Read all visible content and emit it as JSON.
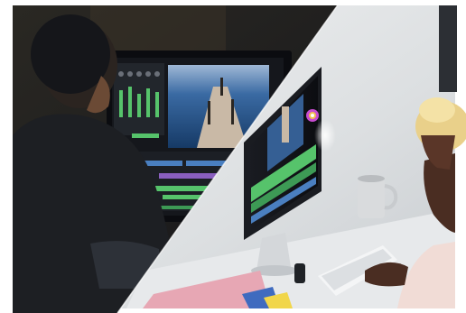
{
  "image": {
    "kind": "photo-collage",
    "panels": [
      "video-editor-dark-room",
      "colorist-bright-office"
    ],
    "left_panel": {
      "subject": "man-at-editing-monitor",
      "monitor_content": [
        "audio-mixer-panel",
        "pier-video-preview",
        "timeline-tracks"
      ]
    },
    "right_panel": {
      "subject": "woman-at-laptop",
      "objects": [
        "angled-monitor",
        "color-wheel-icon",
        "coffee-mug",
        "keyboard",
        "notebooks"
      ]
    },
    "colors": {
      "dark_bg": "#1b1c20",
      "bright_bg": "#e4e6e8",
      "monitor_glow": "#3d6fa8",
      "timeline_green": "#56c36b",
      "color_wheel": "#c84bd1"
    }
  }
}
